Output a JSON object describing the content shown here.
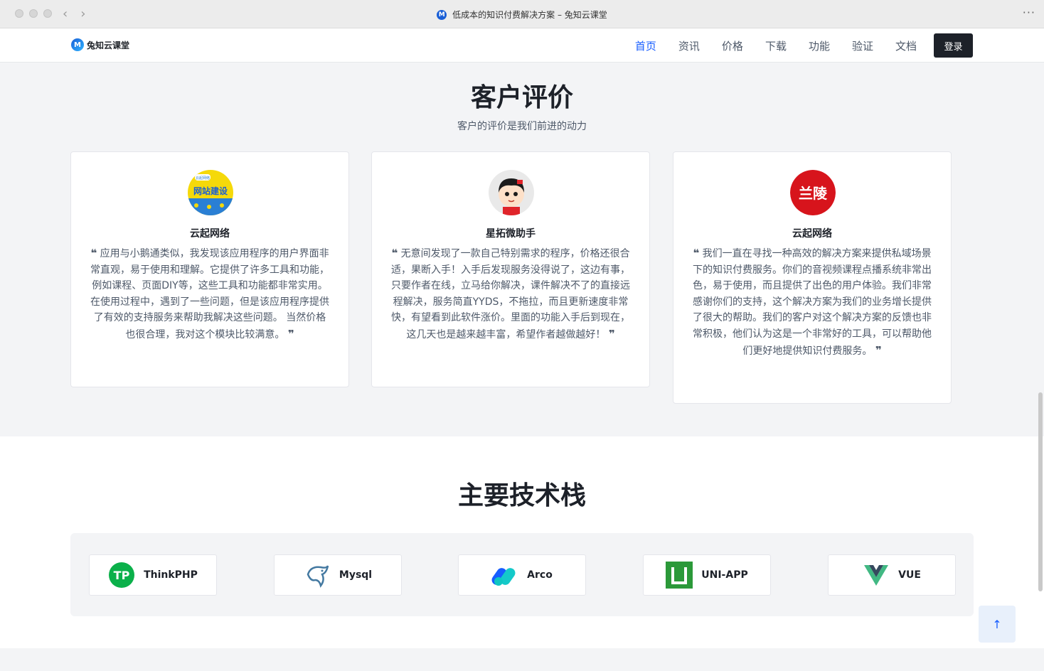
{
  "browser": {
    "tab_title": "低成本的知识付费解决方案 – 兔知云课堂",
    "back": "‹",
    "forward": "›",
    "more": "···",
    "favicon_icon": "brand-logo-icon"
  },
  "header": {
    "logo_text": "兔知云课堂",
    "nav": [
      {
        "label": "首页",
        "active": true
      },
      {
        "label": "资讯"
      },
      {
        "label": "价格"
      },
      {
        "label": "下载"
      },
      {
        "label": "功能"
      },
      {
        "label": "验证"
      },
      {
        "label": "文档"
      }
    ],
    "login_label": "登录"
  },
  "reviews": {
    "title": "客户评价",
    "subtitle": "客户的评价是我们前进的动力",
    "items": [
      {
        "name": "云起网络",
        "text": "应用与小鹅通类似，我发现该应用程序的用户界面非常直观，易于使用和理解。它提供了许多工具和功能，例如课程、页面DIY等，这些工具和功能都非常实用。 在使用过程中，遇到了一些问题，但是该应用程序提供了有效的支持服务来帮助我解决这些问题。 当然价格也很合理，我对这个模块比较满意。"
      },
      {
        "name": "星拓微助手",
        "text": "无意间发现了一款自己特别需求的程序，价格还很合适，果断入手！入手后发现服务没得说了，这边有事，只要作者在线，立马给你解决，课件解决不了的直接远程解决，服务简直YYDS，不拖拉，而且更新速度非常快，有望看到此软件涨价。里面的功能入手后到现在，这几天也是越来越丰富，希望作者越做越好！"
      },
      {
        "name": "云起网络",
        "text": "我们一直在寻找一种高效的解决方案来提供私域场景下的知识付费服务。你们的音视频课程点播系统非常出色，易于使用，而且提供了出色的用户体验。我们非常感谢你们的支持，这个解决方案为我们的业务增长提供了很大的帮助。我们的客户对这个解决方案的反馈也非常积极，他们认为这是一个非常好的工具，可以帮助他们更好地提供知识付费服务。"
      }
    ],
    "avatar1": {
      "top": "网站建设",
      "badge": "云起网络"
    },
    "avatar3": {
      "text": "兰陵"
    },
    "quote_open": "❝",
    "quote_close": "❞"
  },
  "tech": {
    "title": "主要技术栈",
    "items": [
      {
        "label": "ThinkPHP",
        "icon": "thinkphp-icon",
        "color": "#0bb04a"
      },
      {
        "label": "Mysql",
        "icon": "mysql-dolphin-icon",
        "color": "#4479a1"
      },
      {
        "label": "Arco",
        "icon": "arco-icon",
        "color": "#165dff"
      },
      {
        "label": "UNI-APP",
        "icon": "uniapp-icon",
        "color": "#2b9939"
      },
      {
        "label": "VUE",
        "icon": "vue-icon",
        "color": "#41b883"
      }
    ],
    "tp_mark": "TP"
  },
  "back_to_top": "↑"
}
